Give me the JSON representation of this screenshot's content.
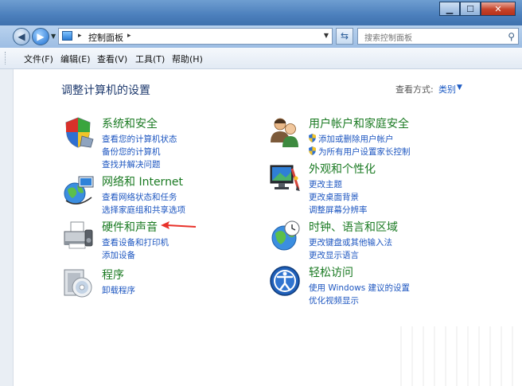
{
  "window": {
    "buttons": {
      "minimize": "▁",
      "maximize": "☐",
      "close": "✕"
    }
  },
  "navbar": {
    "address": {
      "separator": "▸",
      "text": "控制面板",
      "trailing_separator": "▸"
    },
    "search_placeholder": "搜索控制面板"
  },
  "menubar": {
    "items": [
      "文件(F)",
      "编辑(E)",
      "查看(V)",
      "工具(T)",
      "帮助(H)"
    ]
  },
  "main": {
    "title": "调整计算机的设置",
    "view_label": "查看方式:",
    "view_value": "类别",
    "left_categories": [
      {
        "title": "系统和安全",
        "icon": "security-shield-icon",
        "links": [
          "查看您的计算机状态",
          "备份您的计算机",
          "查找并解决问题"
        ]
      },
      {
        "title": "网络和 Internet",
        "icon": "network-globe-icon",
        "links": [
          "查看网络状态和任务",
          "选择家庭组和共享选项"
        ]
      },
      {
        "title": "硬件和声音",
        "icon": "printer-icon",
        "links": [
          "查看设备和打印机",
          "添加设备"
        ]
      },
      {
        "title": "程序",
        "icon": "programs-disc-icon",
        "links": [
          "卸载程序"
        ]
      }
    ],
    "right_categories": [
      {
        "title": "用户帐户和家庭安全",
        "icon": "users-icon",
        "links": [
          "添加或删除用户帐户",
          "为所有用户设置家长控制"
        ]
      },
      {
        "title": "外观和个性化",
        "icon": "appearance-monitor-icon",
        "links": [
          "更改主题",
          "更改桌面背景",
          "调整屏幕分辨率"
        ]
      },
      {
        "title": "时钟、语言和区域",
        "icon": "clock-globe-icon",
        "links": [
          "更改键盘或其他输入法",
          "更改显示语言"
        ]
      },
      {
        "title": "轻松访问",
        "icon": "ease-of-access-icon",
        "links": [
          "使用 Windows 建议的设置",
          "优化视频显示"
        ]
      }
    ]
  },
  "colors": {
    "category_title": "#1a7a22",
    "link": "#1d56c0",
    "page_title": "#1e3a6e",
    "annotation_arrow": "#e8322a"
  }
}
